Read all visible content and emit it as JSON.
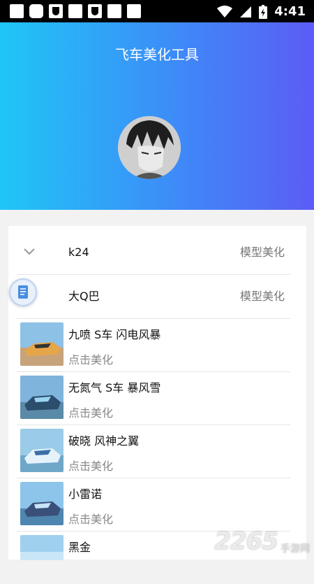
{
  "status_bar": {
    "time": "4:41"
  },
  "header": {
    "title": "飞车美化工具"
  },
  "groups": [
    {
      "name": "k24",
      "tag": "模型美化"
    },
    {
      "name": "大Q巴",
      "tag": "模型美化"
    }
  ],
  "items": [
    {
      "name": "九喷 S车 闪电风暴",
      "action": "点击美化"
    },
    {
      "name": "无氮气 S车 暴风雪",
      "action": "点击美化"
    },
    {
      "name": "破晓 风神之翼",
      "action": "点击美化"
    },
    {
      "name": "小雷诺",
      "action": "点击美化"
    },
    {
      "name": "黑金",
      "action": ""
    }
  ],
  "watermark": {
    "number": "2265",
    "text": "手游网"
  }
}
